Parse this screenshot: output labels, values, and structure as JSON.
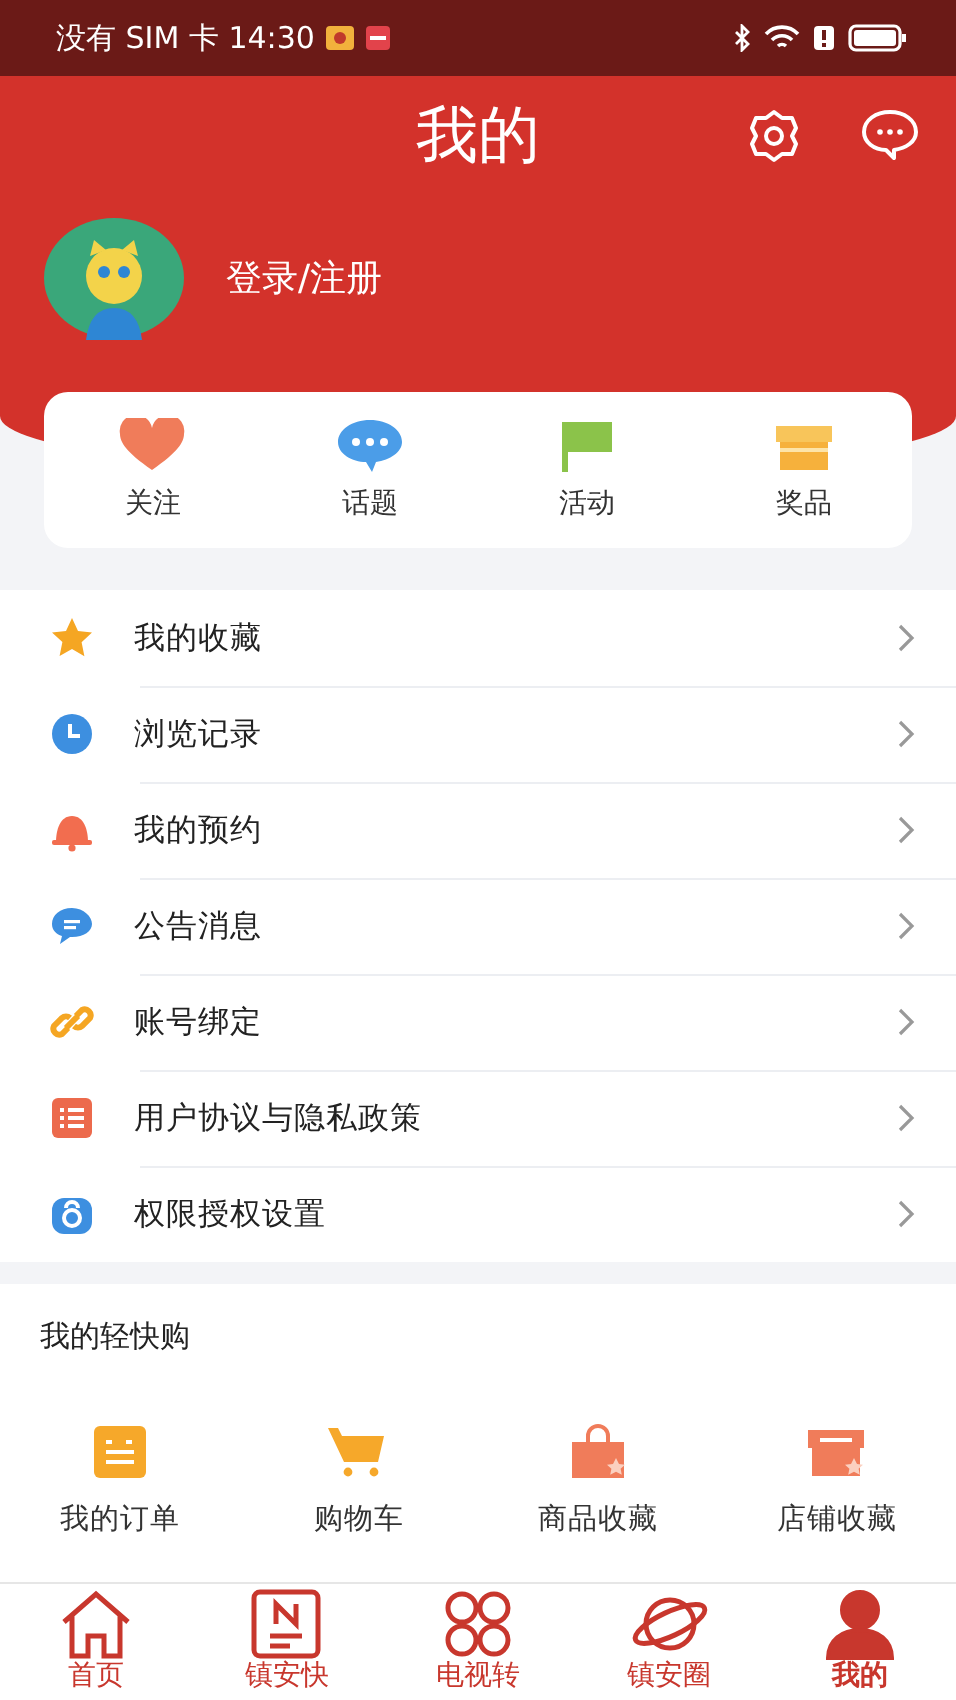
{
  "status_bar": {
    "carrier_time": "没有 SIM 卡 14:30"
  },
  "header": {
    "title": "我的"
  },
  "profile": {
    "login_label": "登录/注册"
  },
  "quick_links": [
    {
      "label": "关注",
      "kind": "heart"
    },
    {
      "label": "话题",
      "kind": "bubble"
    },
    {
      "label": "活动",
      "kind": "flag"
    },
    {
      "label": "奖品",
      "kind": "gift"
    }
  ],
  "menu": [
    {
      "label": "我的收藏",
      "kind": "star"
    },
    {
      "label": "浏览记录",
      "kind": "clock"
    },
    {
      "label": "我的预约",
      "kind": "bell"
    },
    {
      "label": "公告消息",
      "kind": "chat"
    },
    {
      "label": "账号绑定",
      "kind": "link"
    },
    {
      "label": "用户协议与隐私政策",
      "kind": "list"
    },
    {
      "label": "权限授权设置",
      "kind": "lock"
    }
  ],
  "shop": {
    "title": "我的轻快购",
    "items": [
      {
        "label": "我的订单",
        "kind": "order"
      },
      {
        "label": "购物车",
        "kind": "cart"
      },
      {
        "label": "商品收藏",
        "kind": "bag"
      },
      {
        "label": "店铺收藏",
        "kind": "shop"
      }
    ]
  },
  "bottom_nav": [
    {
      "label": "首页",
      "kind": "home",
      "selected": false
    },
    {
      "label": "镇安快",
      "kind": "news",
      "selected": false
    },
    {
      "label": "电视转",
      "kind": "grid",
      "selected": false
    },
    {
      "label": "镇安圈",
      "kind": "planet",
      "selected": false
    },
    {
      "label": "我的",
      "kind": "person",
      "selected": true
    }
  ]
}
